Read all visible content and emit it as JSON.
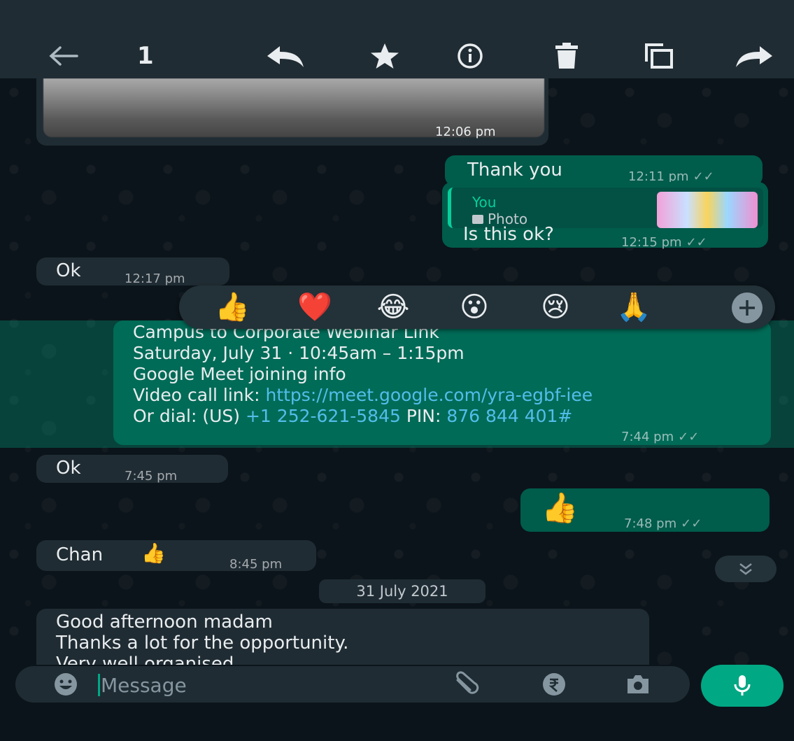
{
  "selection_bar": {
    "count": "1"
  },
  "messages": [
    {
      "time": "12:06 pm"
    },
    {
      "text": "Thank you",
      "time": "12:11 pm",
      "status": "read"
    },
    {
      "quote_sender": "You",
      "quote_type": "Photo",
      "text": "Is this ok?",
      "time": "12:15 pm",
      "status": "read"
    },
    {
      "text": "Ok",
      "time": "12:17 pm"
    },
    {
      "lines": [
        "Campus to Corporate Webinar Link",
        "Saturday, July 31 · 10:45am – 1:15pm",
        "Google Meet joining info"
      ],
      "video_prefix": "Video call link: ",
      "video_link": "https://meet.google.com/yra-egbf-iee",
      "dial_prefix": "Or dial: (US) ",
      "dial_number": "+1 252-621-5845",
      "pin_prefix": " PIN: ",
      "pin": "876 844 401#",
      "time": "7:44 pm",
      "status": "read"
    },
    {
      "text": "Ok",
      "time": "7:45 pm"
    },
    {
      "emoji": "👍",
      "time": "7:48 pm",
      "status": "read"
    },
    {
      "text": "Chan",
      "emoji": "👍",
      "time": "8:45 pm"
    },
    {
      "lines": [
        "Good afternoon madam",
        "Thanks a lot for the opportunity.",
        "Very well organised."
      ]
    }
  ],
  "date_chip": "31 July 2021",
  "reactions": [
    "👍",
    "❤️",
    "😂",
    "😮",
    "😢",
    "🙏"
  ],
  "composer": {
    "placeholder": "Message"
  },
  "colors": {
    "header_bg": "#1f2c33",
    "chat_bg": "#0b141a",
    "incoming_bubble": "#202c33",
    "outgoing_bubble": "#005c4b",
    "accent": "#00a884",
    "link": "#53bdeb"
  }
}
